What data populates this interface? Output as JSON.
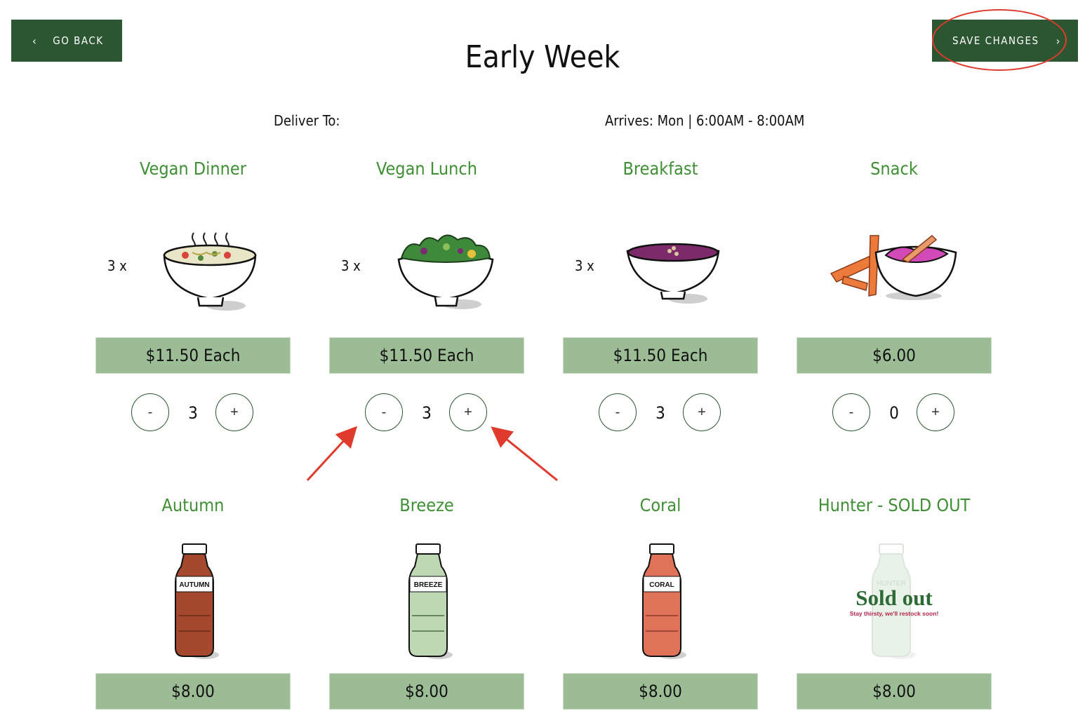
{
  "header": {
    "back_label": "GO BACK",
    "save_label": "SAVE CHANGES",
    "title": "Early Week"
  },
  "delivery": {
    "deliver_to_label": "Deliver To:",
    "arrives_text": "Arrives: Mon | 6:00AM - 8:00AM"
  },
  "meals": [
    {
      "name": "Vegan Dinner",
      "qty_prefix": "3 x",
      "price": "$11.50 Each",
      "quantity": "3",
      "minus": "-",
      "plus": "+",
      "icon": "soup-bowl-icon"
    },
    {
      "name": "Vegan Lunch",
      "qty_prefix": "3 x",
      "price": "$11.50 Each",
      "quantity": "3",
      "minus": "-",
      "plus": "+",
      "icon": "salad-bowl-icon"
    },
    {
      "name": "Breakfast",
      "qty_prefix": "3 x",
      "price": "$11.50 Each",
      "quantity": "3",
      "minus": "-",
      "plus": "+",
      "icon": "berry-bowl-icon"
    },
    {
      "name": "Snack",
      "qty_prefix": "",
      "price": "$6.00",
      "quantity": "0",
      "minus": "-",
      "plus": "+",
      "icon": "dip-bowl-icon"
    }
  ],
  "juices": [
    {
      "name": "Autumn",
      "label": "AUTUMN",
      "price": "$8.00",
      "color": "#a5492e",
      "icon": "juice-bottle-icon"
    },
    {
      "name": "Breeze",
      "label": "BREEZE",
      "price": "$8.00",
      "color": "#bfd8b4",
      "icon": "juice-bottle-icon"
    },
    {
      "name": "Coral",
      "label": "CORAL",
      "price": "$8.00",
      "color": "#e0725a",
      "icon": "juice-bottle-icon"
    },
    {
      "name": "Hunter - SOLD OUT",
      "label": "HUNTER",
      "price": "$8.00",
      "color": "#cfe3cf",
      "icon": "juice-bottle-icon",
      "sold_out_title": "Sold out",
      "sold_out_sub": "Stay thirsty, we'll restock soon!"
    }
  ],
  "colors": {
    "dark_green": "#2c5632",
    "title_green": "#3f8f35",
    "price_green": "#9bbc94",
    "annotation_red": "#e03a2c"
  }
}
